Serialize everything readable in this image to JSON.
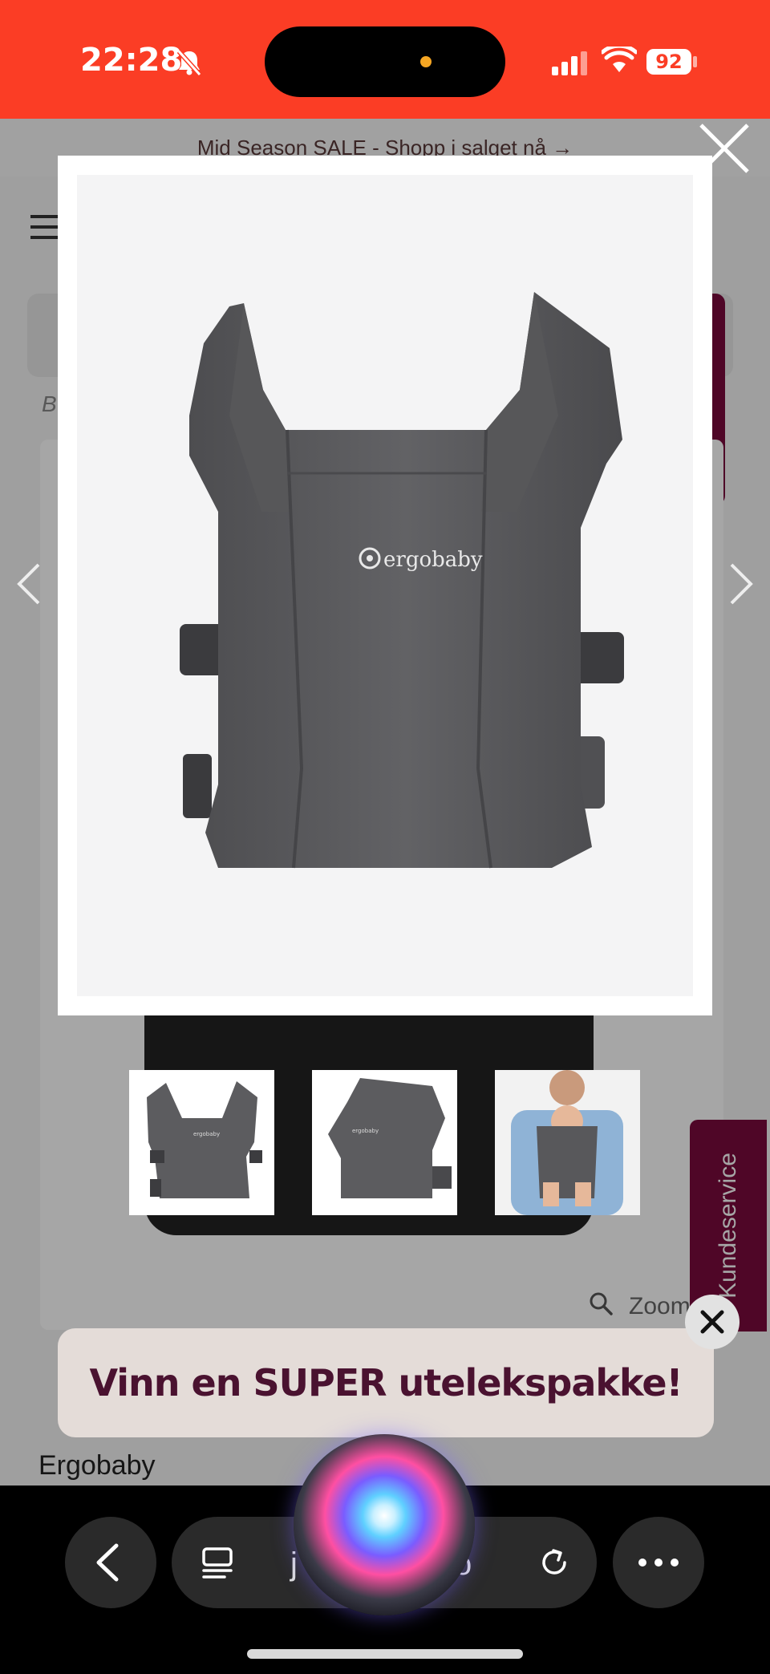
{
  "status_bar": {
    "time": "22:28",
    "battery": "92"
  },
  "promo_bar": {
    "text": "Mid Season SALE - Shopp i salget nå →"
  },
  "page": {
    "breadcrumb_hint": "B",
    "zoom_label": "Zoom",
    "brand": "Ergobaby",
    "customer_service_tab": "Kundeservice"
  },
  "lightbox": {
    "image_logo_text": "ergobaby",
    "thumbnails": [
      {
        "name": "front view"
      },
      {
        "name": "side view"
      },
      {
        "name": "worn with baby"
      }
    ]
  },
  "contest_banner": {
    "text": "Vinn en SUPER utelekspakke!"
  },
  "browser": {
    "url_start": "j",
    "url_end": "o"
  },
  "colors": {
    "status_bar": "#fb3d25",
    "accent_plum": "#7a0a3c",
    "carrier_grey": "#5c5c5e"
  }
}
